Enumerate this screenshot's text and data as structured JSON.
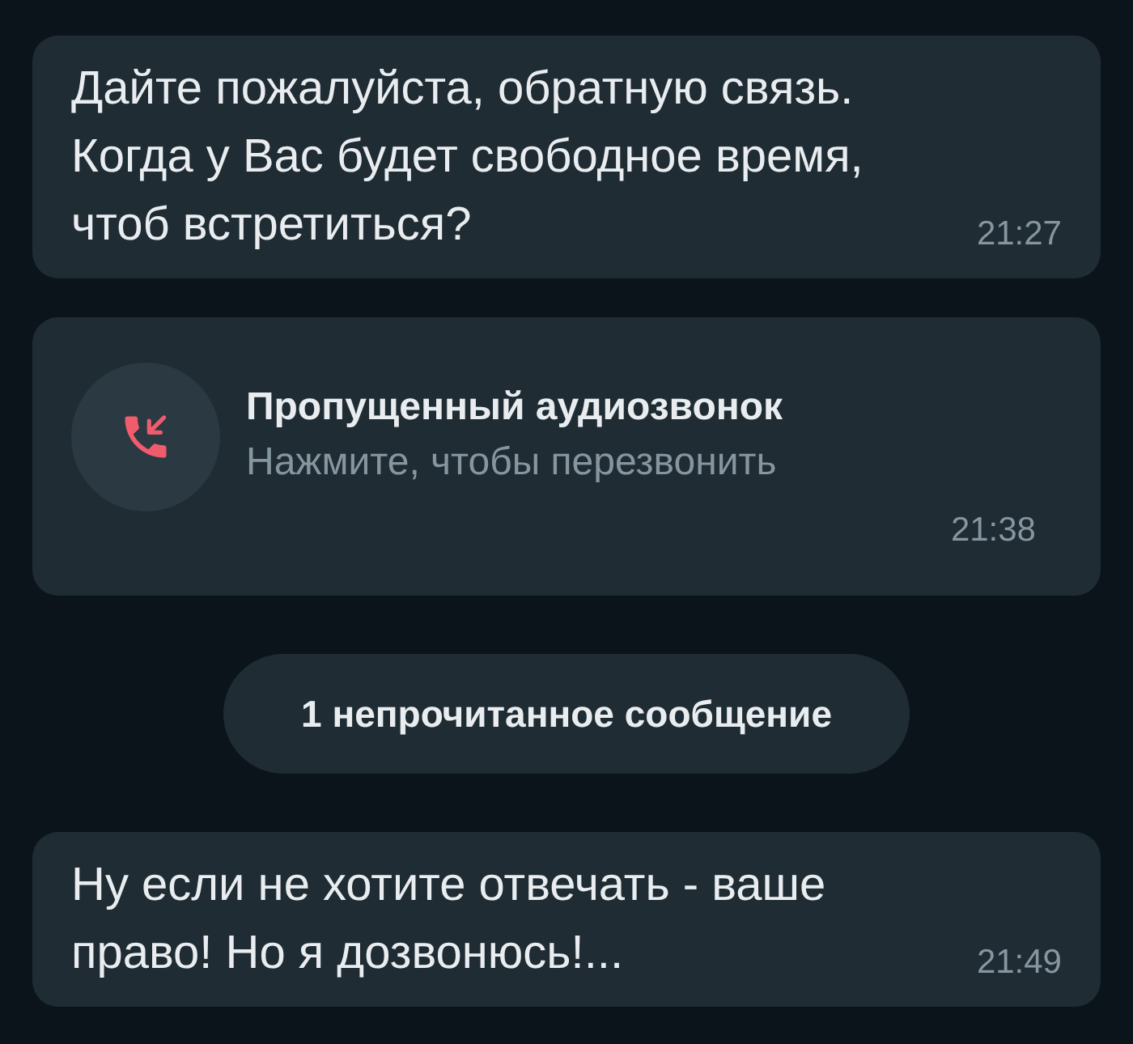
{
  "messages": [
    {
      "kind": "text",
      "text": "Дайте пожалуйста, обратную связь. Когда у Вас будет свободное время, чтоб встретиться?",
      "time": "21:27"
    },
    {
      "kind": "missed_call",
      "title": "Пропущенный аудиозвонок",
      "subtitle": "Нажмите, чтобы перезвонить",
      "time": "21:38"
    },
    {
      "kind": "divider",
      "text": "1 непрочитанное сообщение"
    },
    {
      "kind": "text",
      "text": "Ну если не хотите отвечать - ваше право! Но я дозвонюсь!...",
      "time": "21:49"
    }
  ]
}
